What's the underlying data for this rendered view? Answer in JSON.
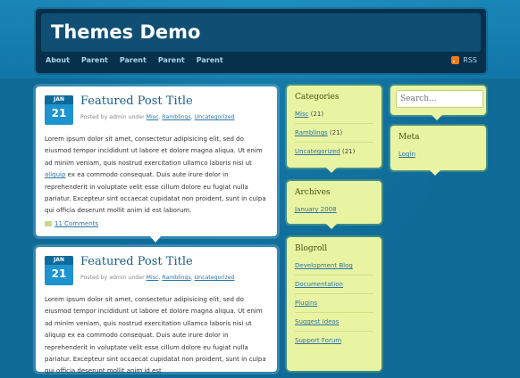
{
  "site": {
    "title": "Themes Demo"
  },
  "nav": {
    "items": [
      "About",
      "Parent",
      "Parent",
      "Parent",
      "Parent"
    ],
    "rss_label": "RSS"
  },
  "posts": [
    {
      "month": "JAN",
      "day": "21",
      "title": "Featured Post Title",
      "meta_prefix": "Posted by admin under",
      "categories": [
        "Misc",
        "Ramblings",
        "Uncategorized"
      ],
      "body_before_link": "Lorem ipsum dolor sit amet, consectetur adipisicing elit, sed do eiusmod tempor incididunt ut labore et dolore magna aliqua. Ut enim ad minim veniam, quis nostrud exercitation ullamco laboris nisi ut ",
      "body_link": "aliquip",
      "body_after_link": " ex ea commodo consequat. Duis aute irure dolor in reprehenderit in voluptate velit esse cillum dolore eu fugiat nulla pariatur. Excepteur sint occaecat cupidatat non proident, sunt in culpa qui officia deserunt mollit anim id est laborum.",
      "comments": "11 Comments"
    },
    {
      "month": "JAN",
      "day": "21",
      "title": "Featured Post Title",
      "meta_prefix": "Posted by admin under",
      "categories": [
        "Misc",
        "Ramblings",
        "Uncategorized"
      ],
      "body": "Lorem ipsum dolor sit amet, consectetur adipisicing elit, sed do eiusmod tempor incididunt ut labore et dolore magna aliqua. Ut enim ad minim veniam, quis nostrud exercitation ullamco laboris nisi ut aliquip ex ea commodo consequat. Duis aute irure dolor in reprehenderit in voluptate velit esse cillum dolore eu fugiat nulla pariatur. Excepteur sint occaecat cupidatat non proident, sunt in culpa qui officia deserunt mollit anim id est"
    }
  ],
  "sidebar": {
    "categories": {
      "title": "Categories",
      "items": [
        {
          "name": "Misc",
          "count": "(21)"
        },
        {
          "name": "Ramblings",
          "count": "(21)"
        },
        {
          "name": "Uncategorized",
          "count": "(21)"
        }
      ]
    },
    "archives": {
      "title": "Archives",
      "items": [
        "January 2008"
      ]
    },
    "blogroll": {
      "title": "Blogroll",
      "items": [
        "Development Blog",
        "Documentation",
        "Plugins",
        "Suggest Ideas",
        "Support Forum"
      ]
    },
    "search": {
      "placeholder": "Search..."
    },
    "meta": {
      "title": "Meta",
      "items": [
        "Login"
      ]
    }
  },
  "colors": {
    "page_bg": "#0f6a96",
    "header_bg": "#07304d",
    "widget_bg": "#e9f4a3",
    "link": "#2a74a8",
    "date_badge": "#1d93cf"
  }
}
